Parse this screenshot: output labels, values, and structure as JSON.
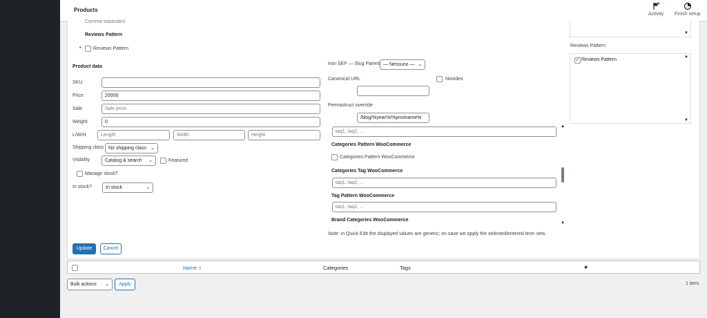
{
  "topbar": {
    "title": "Products",
    "activity_label": "Activity",
    "finish_setup_label": "Finish setup"
  },
  "left": {
    "comma_separated": "Comma-separated",
    "reviews_pattern_heading": "Reviews Pattern",
    "reviews_pattern_checkbox": "Reviews Pattern",
    "product_data_heading": "Product data",
    "sku_label": "SKU",
    "price_label": "Price",
    "price_value": "20000",
    "sale_label": "Sale",
    "sale_placeholder": "Sale price",
    "weight_label": "Weight",
    "weight_value": "0",
    "lwh_label": "L/W/H",
    "length_placeholder": "Length",
    "width_placeholder": "Width",
    "height_placeholder": "Height",
    "shipping_label": "Shipping class",
    "shipping_value": "No shipping class",
    "visibility_label": "Visibility",
    "visibility_value": "Catalog & search",
    "featured_label": "Featured",
    "manage_stock_label": "Manage stock?",
    "in_stock_label": "In stock?",
    "in_stock_value": "In stock"
  },
  "middle": {
    "slug_parent_label": "Iron SEF — Slug Parent",
    "slug_parent_value": "— Nessuno —",
    "canonical_label": "Canonical URL",
    "noindex_label": "Noindex",
    "permastruct_label": "Permastruct override",
    "permastruct_value": "/blog/%year%/%pnstname%",
    "tags_placeholder_1": "taq1, taq2, ...",
    "categories_pattern_heading": "Categories Pattern WooCommerce",
    "categories_pattern_checkbox": "Categories Pattern WooCommerce",
    "categories_tag_heading": "Categories Tag WooCommerce",
    "tags_placeholder_2": "taq1, taq2, ...",
    "tag_pattern_heading": "Tag Pattern WooCommerce",
    "tags_placeholder_3": "taq1, taq2, ...",
    "brand_categories_heading": "Brand Categories WooCommerce",
    "note_prefix": "Note:",
    "note_text": " in Quick Edit the displayed values are generic; on save we apply the selected/entered term sets."
  },
  "right": {
    "reviews_pattern_heading": "Reviews Pattern",
    "reviews_pattern_checkbox": "Reviews Pattern"
  },
  "actions": {
    "update_label": "Update",
    "cancel_label": "Cancel"
  },
  "table": {
    "col_name": "Name",
    "col_categories": "Categories",
    "col_tags": "Tags",
    "col_featured_icon": "★"
  },
  "footer": {
    "bulk_actions_value": "Bulk actions",
    "apply_label": "Apply",
    "items_count": "1 item"
  },
  "colors": {
    "primary": "#2271b1",
    "admin_bar": "#1d2327"
  }
}
